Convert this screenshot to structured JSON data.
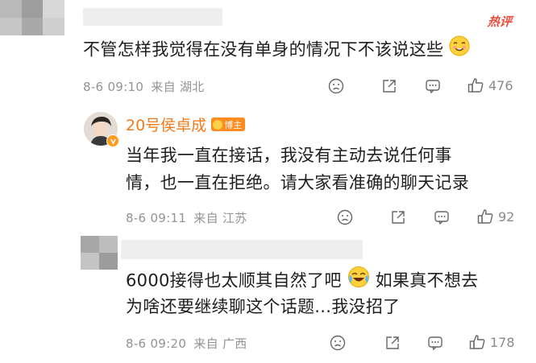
{
  "comments": [
    {
      "hot_label": "热评",
      "text": "不管怎样我觉得在没有单身的情况下不该说这些",
      "emoji_icon": "smile-drool-emoji-icon",
      "time": "8-6 09:10",
      "location": "来自 湖北",
      "likes": "476"
    },
    {
      "author": "20号侯卓成",
      "badge": "博主",
      "text_line1": "当年我一直在接话，我没有主动去说任何事",
      "text_line2": "情，也一直在拒绝。请大家看准确的聊天记录",
      "time": "8-6 09:11",
      "location": "来自 江苏",
      "likes": "92"
    },
    {
      "text_line1_a": "6000接得也太顺其自然了吧",
      "text_line1_b": "如果真不想去",
      "text_line2": "为啥还要继续聊这个话题...我没招了",
      "emoji_icon": "crying-laugh-emoji-icon",
      "time": "8-6 09:20",
      "location": "来自 广西",
      "likes": "178"
    }
  ],
  "colors": {
    "author": "#f07b1c",
    "hot": "#ef4b3b",
    "meta": "#939393"
  }
}
